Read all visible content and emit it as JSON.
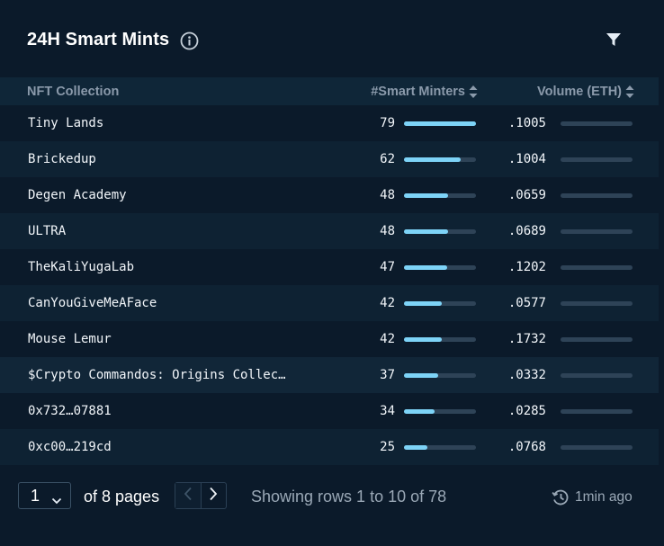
{
  "header": {
    "title": "24H Smart Mints",
    "info_icon": "info-icon",
    "filter_icon": "filter-icon"
  },
  "table": {
    "columns": {
      "name": "NFT Collection",
      "minters": "#Smart Minters",
      "volume": "Volume (ETH)"
    },
    "rows": [
      {
        "name": "Tiny Lands",
        "minters": "79",
        "minters_fill": 1.0,
        "volume": ".1005",
        "volume_fill": 0.0
      },
      {
        "name": "Brickedup",
        "minters": "62",
        "minters_fill": 0.79,
        "volume": ".1004",
        "volume_fill": 0.0
      },
      {
        "name": "Degen Academy",
        "minters": "48",
        "minters_fill": 0.61,
        "volume": ".0659",
        "volume_fill": 0.0
      },
      {
        "name": "ULTRA",
        "minters": "48",
        "minters_fill": 0.61,
        "volume": ".0689",
        "volume_fill": 0.0
      },
      {
        "name": "TheKaliYugaLab",
        "minters": "47",
        "minters_fill": 0.6,
        "volume": ".1202",
        "volume_fill": 0.0
      },
      {
        "name": "CanYouGiveMeAFace",
        "minters": "42",
        "minters_fill": 0.53,
        "volume": ".0577",
        "volume_fill": 0.0
      },
      {
        "name": "Mouse Lemur",
        "minters": "42",
        "minters_fill": 0.53,
        "volume": ".1732",
        "volume_fill": 0.0
      },
      {
        "name": "$Crypto Commandos: Origins Collec…",
        "minters": "37",
        "minters_fill": 0.47,
        "volume": ".0332",
        "volume_fill": 0.0
      },
      {
        "name": "0x732…07881",
        "minters": "34",
        "minters_fill": 0.43,
        "volume": ".0285",
        "volume_fill": 0.0
      },
      {
        "name": "0xc00…219cd",
        "minters": "25",
        "minters_fill": 0.32,
        "volume": ".0768",
        "volume_fill": 0.0
      }
    ]
  },
  "footer": {
    "page_value": "1",
    "of_pages": "of 8 pages",
    "showing": "Showing rows 1 to 10 of 78",
    "updated": "1min ago"
  },
  "colors": {
    "background": "#0b1a2a",
    "bar_fill": "#7dd3f7",
    "bar_track": "#2e4357"
  }
}
